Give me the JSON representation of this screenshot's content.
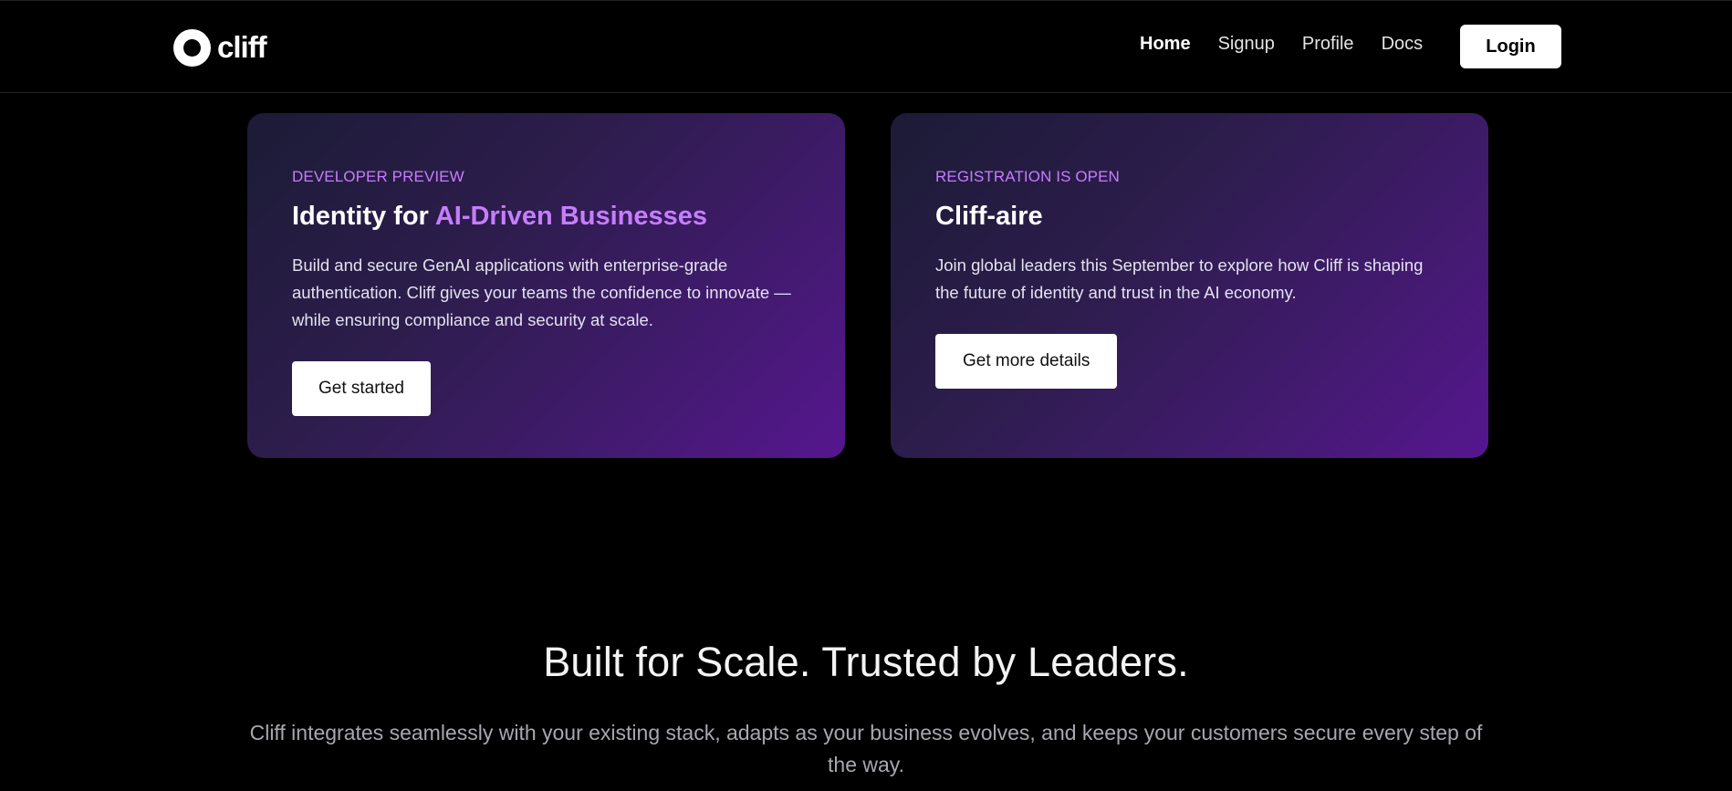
{
  "header": {
    "brand": "cliff",
    "nav": [
      {
        "label": "Home",
        "active": true
      },
      {
        "label": "Signup",
        "active": false
      },
      {
        "label": "Profile",
        "active": false
      },
      {
        "label": "Docs",
        "active": false
      }
    ],
    "login_label": "Login"
  },
  "cards": [
    {
      "eyebrow": "DEVELOPER PREVIEW",
      "title_prefix": "Identity for ",
      "title_accent": "AI-Driven Businesses",
      "body": "Build and secure GenAI applications with enterprise-grade authentication. Cliff gives your teams the confidence to innovate — while ensuring compliance and security at scale.",
      "button_label": "Get started"
    },
    {
      "eyebrow": "REGISTRATION IS OPEN",
      "title": "Cliff-aire",
      "body": "Join global leaders this September to explore how Cliff is shaping the future of identity and trust in the AI economy.",
      "button_label": "Get more details"
    }
  ],
  "section": {
    "title": "Built for Scale. Trusted by Leaders.",
    "subtitle": "Cliff integrates seamlessly with your existing stack, adapts as your business evolves, and keeps your customers secure every step of the way."
  },
  "colors": {
    "background": "#000000",
    "accent": "#c77dff",
    "card_gradient_start": "#1c1b36",
    "card_gradient_end": "#56168f"
  },
  "icons": {
    "logo": "ring-logo-icon"
  }
}
